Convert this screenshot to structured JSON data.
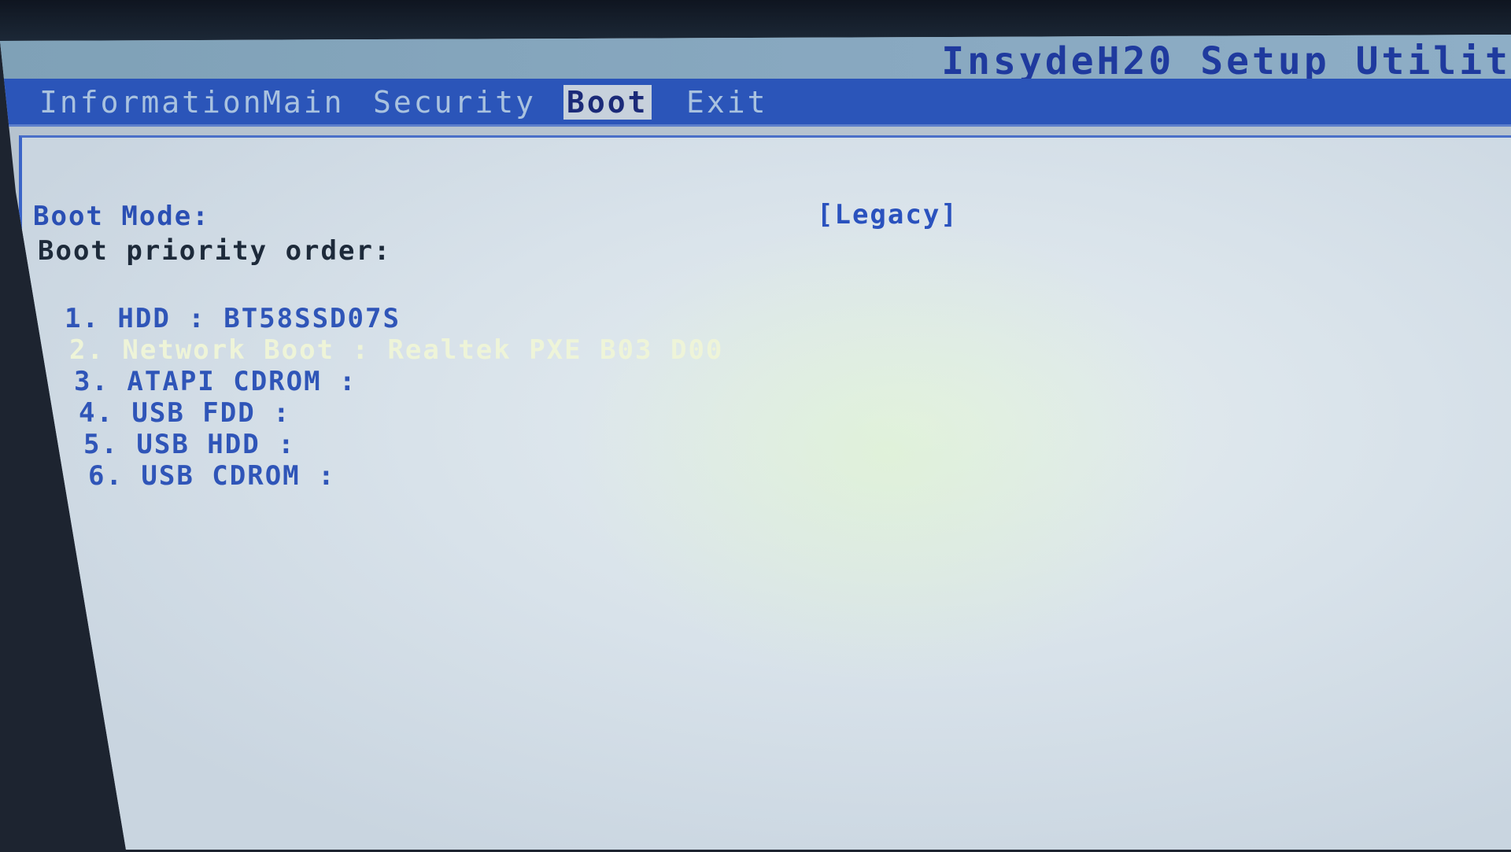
{
  "app": {
    "title": "InsydeH20 Setup Utilit"
  },
  "menu": [
    {
      "label": "Information"
    },
    {
      "label": "Main"
    },
    {
      "label": "Security"
    },
    {
      "label": "Boot"
    },
    {
      "label": "Exit"
    }
  ],
  "boot": {
    "mode_label": "Boot Mode:",
    "mode_value": "[Legacy]",
    "priority_label": "Boot priority order:",
    "items": [
      {
        "text": "1. HDD : BT58SSD07S"
      },
      {
        "text": "2. Network Boot : Realtek PXE B03 D00"
      },
      {
        "text": "3. ATAPI CDROM :"
      },
      {
        "text": "4. USB FDD :"
      },
      {
        "text": "5. USB HDD :"
      },
      {
        "text": "6. USB CDROM :"
      }
    ]
  },
  "colors": {
    "menu_bar": "#2b55b9",
    "active_tab": "#c7d1dc",
    "text_blue": "#2a4fb4"
  }
}
